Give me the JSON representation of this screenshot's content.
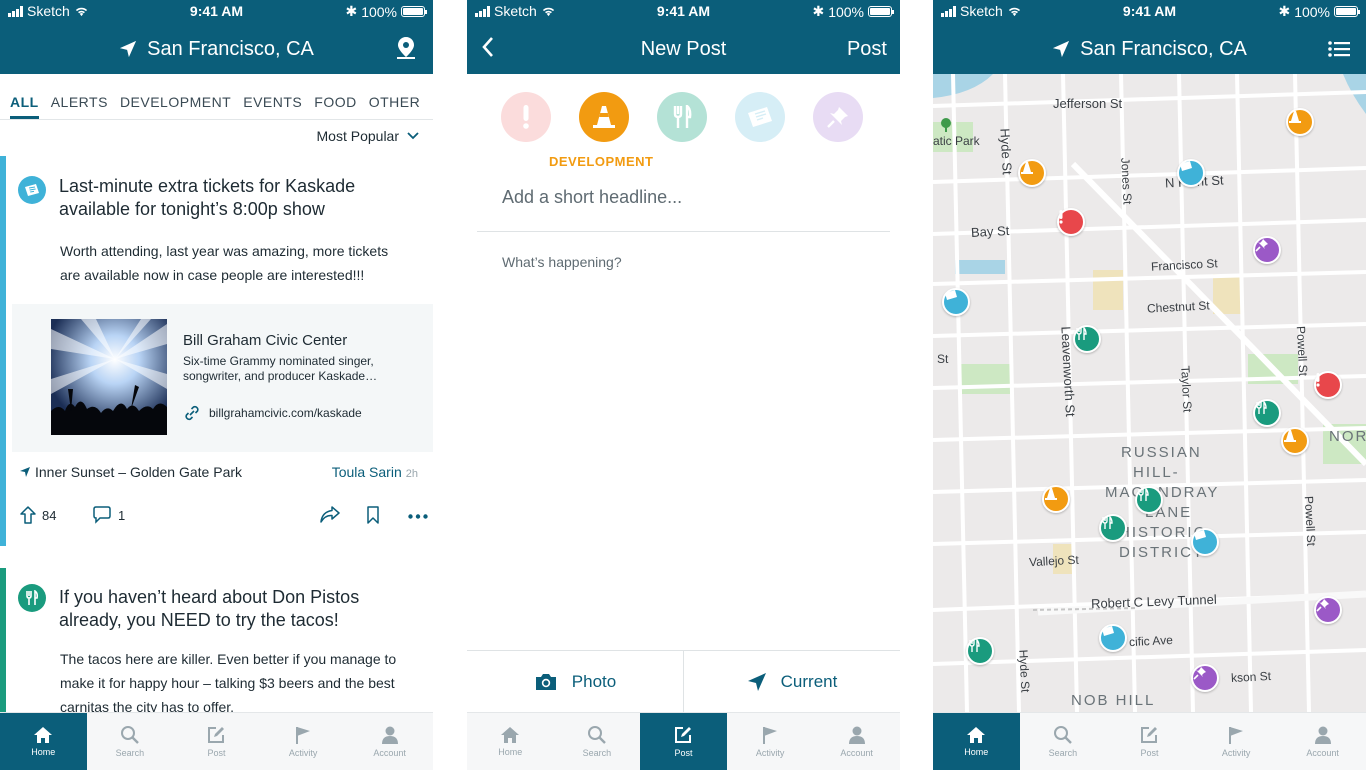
{
  "status_bar": {
    "carrier": "Sketch",
    "time": "9:41 AM",
    "battery": "100%"
  },
  "colors": {
    "primary": "#0b5e7a",
    "events": "#3fb2d8",
    "food": "#1a9b7e",
    "development": "#f29b11",
    "alert": "#e8474b",
    "other": "#9b59c7"
  },
  "feed": {
    "header_title": "San Francisco, CA",
    "header_icon": "location-pin-icon",
    "tabs": [
      "ALL",
      "ALERTS",
      "DEVELOPMENT",
      "EVENTS",
      "FOOD",
      "OTHER"
    ],
    "active_tab": "ALL",
    "sort_label": "Most Popular",
    "posts": [
      {
        "category_icon": "ticket-icon",
        "title": "Last-minute extra tickets for Kaskade available for tonight’s 8:00p show",
        "body": "Worth attending, last year was amazing, more tickets are available now in case people are interested!!!",
        "link": {
          "title": "Bill Graham Civic Center",
          "description": "Six-time Grammy nominated singer, songwriter, and producer Kaskade…",
          "url": "billgrahamcivic.com/kaskade"
        },
        "location": "Inner Sunset – Golden Gate Park",
        "author": "Toula Sarin",
        "time": "2h",
        "upvotes": "84",
        "comments": "1"
      },
      {
        "category_icon": "fork-knife-icon",
        "title": "If you haven’t heard about Don Pistos already, you NEED to try the tacos!",
        "body": "The tacos here are killer. Even better if you manage to make it for happy hour – talking $3 beers and the best carnitas the city has to offer."
      }
    ]
  },
  "new_post": {
    "header_title": "New Post",
    "post_button": "Post",
    "selected_category": "DEVELOPMENT",
    "category_icons": [
      "alert-icon",
      "traffic-cone-icon",
      "fork-knife-icon",
      "ticket-icon",
      "pushpin-icon"
    ],
    "headline_placeholder": "Add a short headline...",
    "body_placeholder": "What’s happening?",
    "photo_button": "Photo",
    "location_button": "Current"
  },
  "map": {
    "header_title": "San Francisco, CA",
    "header_icon": "list-icon",
    "street_labels": [
      "Jefferson St",
      "N Point St",
      "Bay St",
      "Francisco St",
      "Chestnut St",
      "Hyde St",
      "Jones St",
      "Leavenworth St",
      "Taylor St",
      "Powell St",
      "Vallejo St",
      "Robert C Levy Tunnel",
      "cific Ave",
      "kson St",
      "atic Park",
      "St"
    ],
    "district_labels": [
      "RUSSIAN",
      "HILL-",
      "MACONDRAY",
      "LANE",
      "HISTORIC",
      "DISTRICT",
      "NOB HILL",
      "NORTH"
    ]
  },
  "bottom_nav": [
    "Home",
    "Search",
    "Post",
    "Activity",
    "Account"
  ]
}
